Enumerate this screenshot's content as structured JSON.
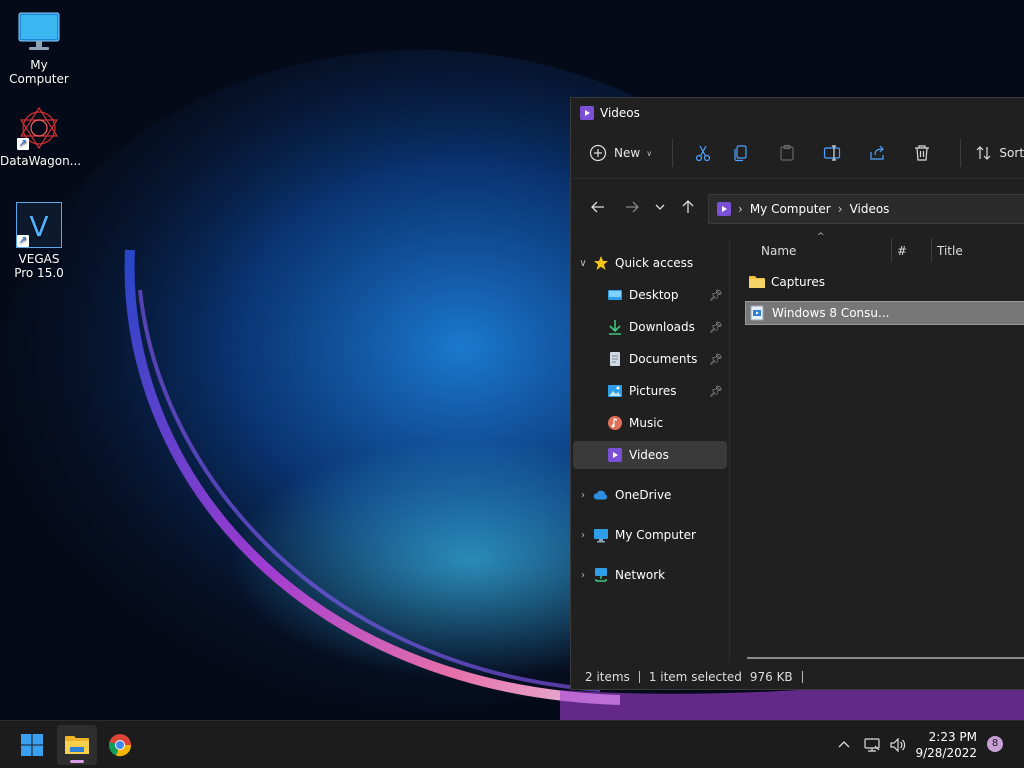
{
  "desktop": {
    "icons": [
      {
        "label": "My Computer"
      },
      {
        "label": "DataWagon..."
      },
      {
        "label": "VEGAS Pro 15.0"
      }
    ]
  },
  "explorer": {
    "title": "Videos",
    "toolbar": {
      "new_label": "New",
      "sort_label": "Sort"
    },
    "address": {
      "crumbs": [
        "My Computer",
        "Videos"
      ]
    },
    "nav": {
      "quick_access": "Quick access",
      "items": [
        {
          "label": "Desktop",
          "pinned": true
        },
        {
          "label": "Downloads",
          "pinned": true
        },
        {
          "label": "Documents",
          "pinned": true
        },
        {
          "label": "Pictures",
          "pinned": true
        },
        {
          "label": "Music",
          "pinned": false
        },
        {
          "label": "Videos",
          "pinned": false
        }
      ],
      "onedrive": "OneDrive",
      "my_computer": "My Computer",
      "network": "Network"
    },
    "columns": {
      "name": "Name",
      "number": "#",
      "title": "Title"
    },
    "files": [
      {
        "name": "Captures",
        "type": "folder"
      },
      {
        "name": "Windows 8 Consu...",
        "type": "video",
        "selected": true
      }
    ],
    "status": {
      "items": "2 items",
      "selected": "1 item selected",
      "size": "976 KB"
    }
  },
  "taskbar": {
    "time": "2:23 PM",
    "date": "9/28/2022",
    "notification_count": "8"
  },
  "colors": {
    "accent": "#7b4fd6",
    "folder": "#f0c240",
    "window_bg": "#202020",
    "taskbar_bg": "#1c1c1c"
  }
}
